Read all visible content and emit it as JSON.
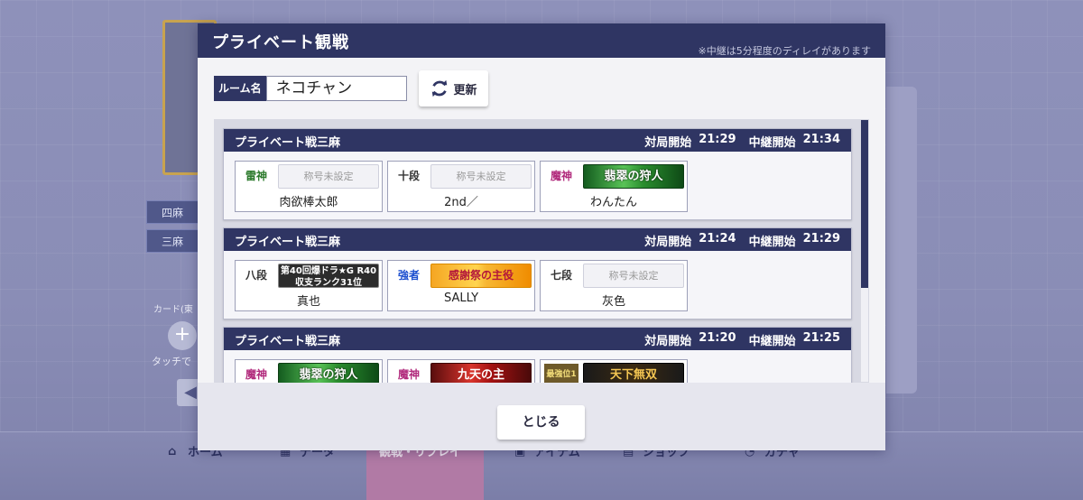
{
  "modal": {
    "title": "プライベート観戦",
    "delay_note": "※中継は5分程度のディレイがあります",
    "room_label": "ルーム名",
    "room_value": "ネコチャン",
    "refresh_label": "更新",
    "close_label": "とじる"
  },
  "matches": [
    {
      "name": "プライベート戦三麻",
      "start_label": "対局開始",
      "start_time": "21:29",
      "relay_label": "中継開始",
      "relay_time": "21:34",
      "players": [
        {
          "rank": "雷神",
          "rank_style": "raijin",
          "title": "称号未設定",
          "title_style": "none",
          "name": "肉欲棒太郎"
        },
        {
          "rank": "十段",
          "rank_style": "plain",
          "title": "称号未設定",
          "title_style": "none",
          "name": "2nd／"
        },
        {
          "rank": "魔神",
          "rank_style": "majin",
          "title": "翡翠の狩人",
          "title_style": "green",
          "name": "わんたん"
        }
      ]
    },
    {
      "name": "プライベート戦三麻",
      "start_label": "対局開始",
      "start_time": "21:24",
      "relay_label": "中継開始",
      "relay_time": "21:29",
      "players": [
        {
          "rank": "八段",
          "rank_style": "plain",
          "title": "第40回爆ドラ★G R40収支ランク31位",
          "title_style": "dark",
          "name": "真也"
        },
        {
          "rank": "強者",
          "rank_style": "kyosha",
          "title": "感謝祭の主役",
          "title_style": "gold",
          "name": "SALLY"
        },
        {
          "rank": "七段",
          "rank_style": "plain",
          "title": "称号未設定",
          "title_style": "none",
          "name": "灰色"
        }
      ]
    },
    {
      "name": "プライベート戦三麻",
      "start_label": "対局開始",
      "start_time": "21:20",
      "relay_label": "中継開始",
      "relay_time": "21:25",
      "players": [
        {
          "rank": "魔神",
          "rank_style": "majin",
          "title": "翡翠の狩人",
          "title_style": "green",
          "name": ""
        },
        {
          "rank": "魔神",
          "rank_style": "majin",
          "title": "九天の主",
          "title_style": "red",
          "name": ""
        },
        {
          "rank": "最強位1",
          "rank_style": "saikyo",
          "title": "天下無双",
          "title_style": "black",
          "name": ""
        }
      ]
    }
  ],
  "background": {
    "tag_four": "四麻",
    "tag_three": "三麻",
    "card_label": "カード(東",
    "touch_label": "タッチで",
    "nav": [
      "ホーム",
      "データ",
      "観戦・リプレイ",
      "アイテム",
      "ショップ",
      "ガチャ"
    ]
  },
  "colors": {
    "header_navy": "#2f3563",
    "modal_bg": "#f3f3f6"
  }
}
